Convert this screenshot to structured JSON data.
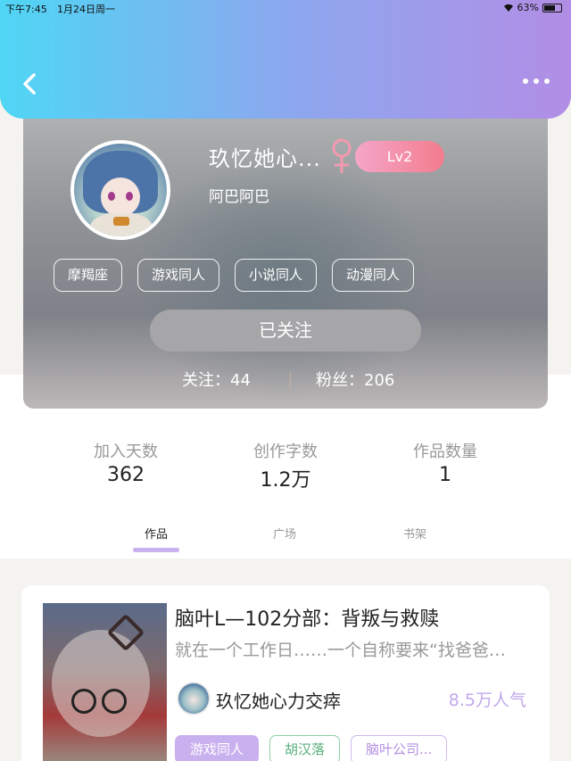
{
  "status_bar": {
    "time": "下午7:45",
    "date": "1月24日周一",
    "battery": "63%"
  },
  "header": {
    "back_icon": "chevron-left-icon",
    "more_icon": "more-horizontal-icon"
  },
  "profile": {
    "nickname": "玖忆她心...",
    "gender": "female",
    "gender_symbol": "♀",
    "gender_color": "#f49ab0",
    "level": "Lv2",
    "signature": "阿巴阿巴",
    "tags": [
      "摩羯座",
      "游戏同人",
      "小说同人",
      "动漫同人"
    ],
    "follow_button": "已关注",
    "following_label": "关注：44",
    "fans_label": "粉丝：206"
  },
  "stats": {
    "days_label": "加入天数",
    "days_value": "362",
    "words_label": "创作字数",
    "words_value": "1.2万",
    "works_label": "作品数量",
    "works_value": "1"
  },
  "tabs": [
    {
      "label": "作品",
      "active": true
    },
    {
      "label": "广场",
      "active": false
    },
    {
      "label": "书架",
      "active": false
    }
  ],
  "work": {
    "title": "脑叶L—102分部：背叛与救赎",
    "description": "就在一个工作日……一个自称要来“找爸爸…",
    "author": "玖忆她心力交瘁",
    "popularity": "8.5万人气",
    "tags": [
      "游戏同人",
      "胡汉落",
      "脑叶公司..."
    ]
  },
  "colors": {
    "accent": "#c7b2ee",
    "gradient_start": "#4fd6f5",
    "gradient_end": "#b28ee6",
    "level_badge": "#f27c8e"
  }
}
